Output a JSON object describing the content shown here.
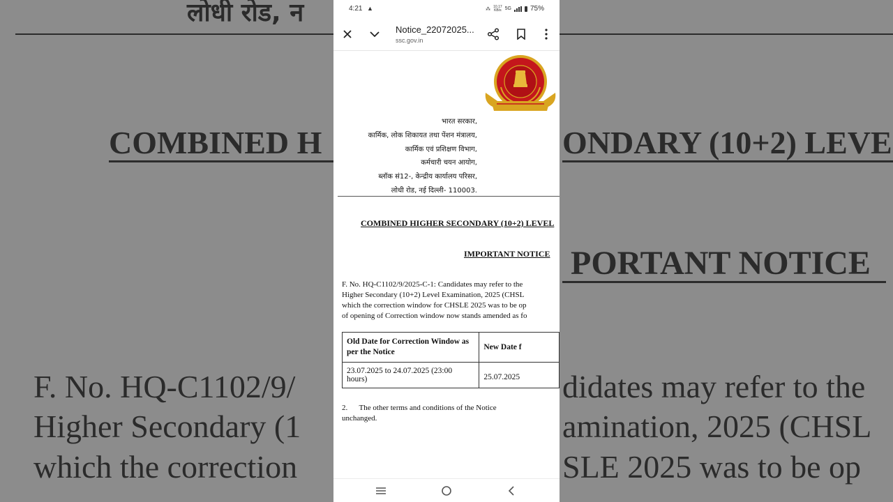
{
  "background": {
    "line1": "लोधी रोड, न",
    "line2": "COMBINED H",
    "line2b": "ONDARY (10+2) LEVE",
    "line3": "PORTANT NOTICE",
    "line4a": "F. No. HQ-C1102/9/",
    "line4b": "didates may refer to the",
    "line5a": "Higher Secondary (1",
    "line5b": "amination, 2025 (CHSL",
    "line6a": "which the correction",
    "line6b": "SLE 2025 was to be op"
  },
  "status_bar": {
    "time": "4:21",
    "network_speed": "10.17",
    "network_unit": "KB/s",
    "network_type": "5G",
    "battery": "75%"
  },
  "app_bar": {
    "title": "Notice_22072025...",
    "url": "ssc.gov.in"
  },
  "document": {
    "address_lines": [
      "भारत सरकार,",
      "कार्मिक, लोक शिकायत तथा पेंशन मंत्रालय,",
      "कार्मिक एवं प्रशिक्षण विभाग,",
      "कर्मचारी चयन आयोग,",
      "ब्लॉक सं12-, केन्द्रीय कार्यालय परिसर,",
      "लोधी रोड, नई दिल्ली- 110003."
    ],
    "heading": "COMBINED HIGHER SECONDARY (10+2) LEVEL",
    "important_notice": "IMPORTANT NOTICE",
    "paragraph_lines": [
      "F. No. HQ-C1102/9/2025-C-1: Candidates may refer to the",
      "Higher Secondary (10+2) Level Examination, 2025 (CHSL",
      "which the correction window for CHSLE 2025 was to be op",
      "of opening of Correction window now stands amended as fo"
    ],
    "table": {
      "headers": [
        "Old Date for Correction Window as per the Notice",
        "New Date f"
      ],
      "rows": [
        [
          "23.07.2025 to 24.07.2025 (23:00 hours)",
          "25.07.2025"
        ]
      ]
    },
    "point2_lines": [
      "2.      The other terms and conditions of the Notice",
      "unchanged."
    ]
  },
  "colors": {
    "background": "#8c8c8c",
    "logo_red": "#c4161c",
    "logo_gold": "#d9a521"
  },
  "icons": [
    "close-icon",
    "chevron-down-icon",
    "share-icon",
    "bookmark-icon",
    "more-vert-icon",
    "recents-icon",
    "home-icon",
    "back-icon"
  ]
}
